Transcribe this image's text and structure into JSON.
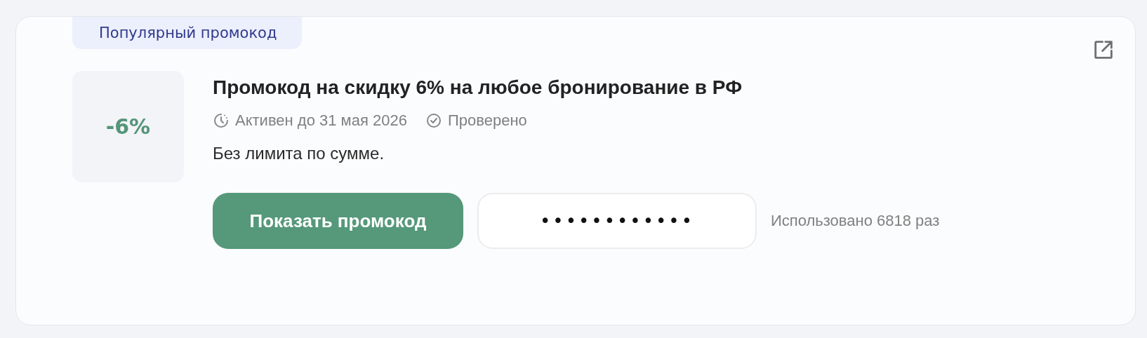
{
  "promo": {
    "badge": "Популярный промокод",
    "discount": "-6%",
    "title": "Промокод на скидку 6% на любое бронирование в РФ",
    "active_until": "Активен до 31 мая 2026",
    "verified": true,
    "verified_label": "Проверено",
    "description": "Без лимита по сумме.",
    "button": "Показать промокод",
    "code": "••••••••••••",
    "usage": "Использовано 6818 раз"
  }
}
